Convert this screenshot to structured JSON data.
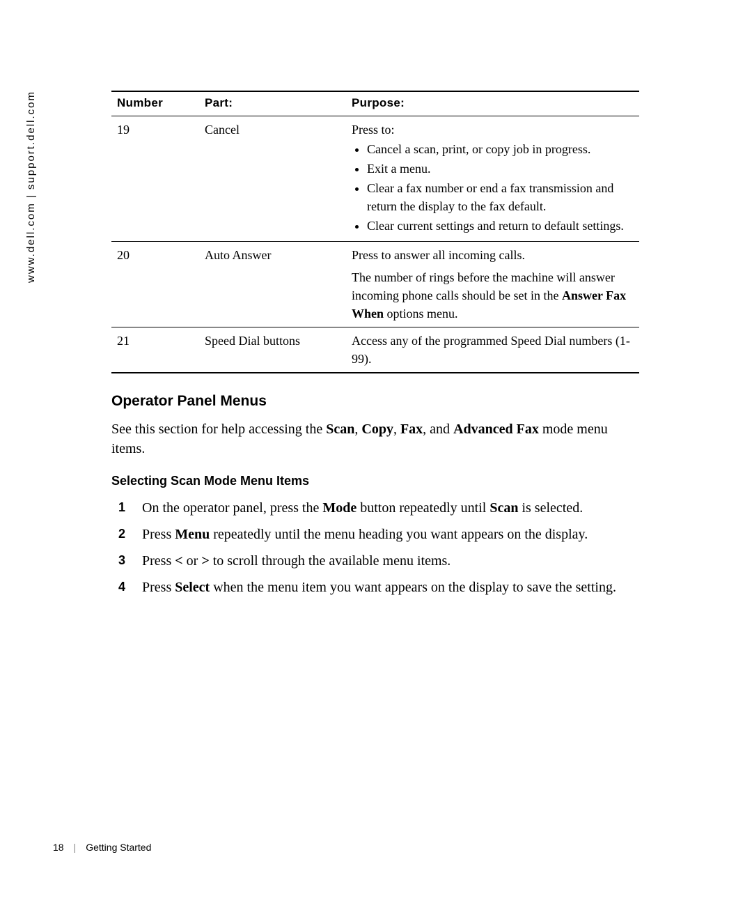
{
  "side_url": "www.dell.com | support.dell.com",
  "table": {
    "headers": {
      "number": "Number",
      "part": "Part:",
      "purpose": "Purpose:"
    },
    "rows": [
      {
        "number": "19",
        "part": "Cancel",
        "purpose_intro": "Press to:",
        "bullets": [
          "Cancel a scan, print, or copy job in progress.",
          "Exit a menu.",
          "Clear a fax number or end a fax transmission and return the display to the fax default.",
          "Clear current settings and return to default settings."
        ]
      },
      {
        "number": "20",
        "part": "Auto Answer",
        "purpose_line1": "Press to answer all incoming calls.",
        "purpose_line2_pre": "The number of rings before the machine will answer incoming phone calls should be set in the ",
        "purpose_line2_bold": "Answer Fax When",
        "purpose_line2_post": " options menu."
      },
      {
        "number": "21",
        "part": "Speed Dial buttons",
        "purpose_line": "Access any of the programmed Speed Dial numbers (1-99)."
      }
    ]
  },
  "section_heading": "Operator Panel Menus",
  "intro": {
    "pre": "See this section for help accessing the ",
    "b1": "Scan",
    "sep1": ", ",
    "b2": "Copy",
    "sep2": ", ",
    "b3": "Fax",
    "sep3": ", and ",
    "b4": "Advanced Fax",
    "post": " mode menu items."
  },
  "sub_heading": "Selecting Scan Mode Menu Items",
  "steps": [
    {
      "pre": "On the operator panel, press the ",
      "b1": "Mode",
      "mid": " button repeatedly until ",
      "b2": "Scan",
      "post": " is selected."
    },
    {
      "pre": "Press ",
      "b1": "Menu",
      "post": " repeatedly until the menu heading you want appears on the display."
    },
    {
      "pre": "Press ",
      "b1": "<",
      "mid": " or ",
      "b2": ">",
      "post": " to scroll through the available menu items."
    },
    {
      "pre": "Press ",
      "b1": "Select",
      "post": " when the menu item you want appears on the display to save the setting."
    }
  ],
  "footer": {
    "page": "18",
    "sep": "|",
    "section": "Getting Started"
  }
}
